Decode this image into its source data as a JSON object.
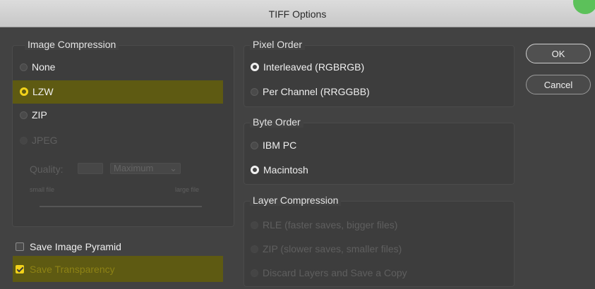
{
  "window": {
    "title": "TIFF Options"
  },
  "image_compression": {
    "title": "Image Compression",
    "options": [
      "None",
      "LZW",
      "ZIP",
      "JPEG"
    ],
    "selected": "LZW",
    "quality_label": "Quality:",
    "quality_value": "",
    "quality_preset": "Maximum",
    "small_file_label": "small file",
    "large_file_label": "large file"
  },
  "checkboxes": {
    "save_image_pyramid": {
      "label": "Save Image Pyramid",
      "checked": false
    },
    "save_transparency": {
      "label": "Save Transparency",
      "checked": true
    }
  },
  "pixel_order": {
    "title": "Pixel Order",
    "options": [
      "Interleaved (RGBRGB)",
      "Per Channel (RRGGBB)"
    ],
    "selected": "Interleaved (RGBRGB)"
  },
  "byte_order": {
    "title": "Byte Order",
    "options": [
      "IBM PC",
      "Macintosh"
    ],
    "selected": "Macintosh"
  },
  "layer_compression": {
    "title": "Layer Compression",
    "options": [
      "RLE (faster saves, bigger files)",
      "ZIP (slower saves, smaller files)",
      "Discard Layers and Save a Copy"
    ]
  },
  "buttons": {
    "ok": "OK",
    "cancel": "Cancel"
  },
  "colors": {
    "highlight": "#5e5a12",
    "accent_yellow": "#f2d21a",
    "background": "#424242"
  }
}
